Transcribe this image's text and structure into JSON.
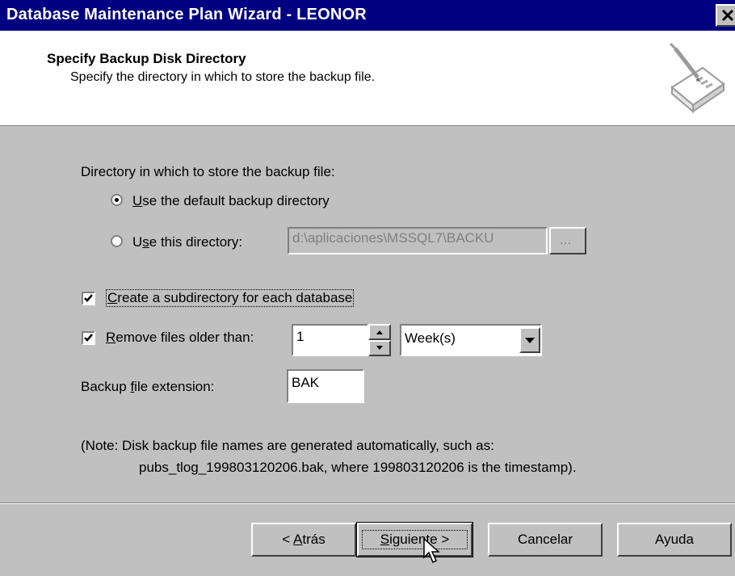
{
  "window": {
    "title": "Database Maintenance Plan Wizard - LEONOR"
  },
  "header": {
    "title": "Specify Backup Disk Directory",
    "subtitle": "Specify the directory in which to store the backup file."
  },
  "form": {
    "directory_label": "Directory in which to store the backup file:",
    "radio_default": {
      "u": "U",
      "rest": "se the default backup directory",
      "selected": true
    },
    "radio_this": {
      "pre": "U",
      "u": "s",
      "rest": "e this directory:",
      "selected": false
    },
    "directory_value": "d:\\aplicaciones\\MSSQL7\\BACKU",
    "browse_label": "...",
    "create_subdir": {
      "u": "C",
      "rest": "reate a subdirectory for each database",
      "checked": true
    },
    "remove_files": {
      "u": "R",
      "rest": "emove files older than:",
      "checked": true
    },
    "remove_count": "1",
    "remove_unit": "Week(s)",
    "extension_label": {
      "pre": "Backup ",
      "u": "f",
      "rest": "ile extension:"
    },
    "extension_value": "BAK",
    "note_line1": "(Note: Disk backup file names are generated automatically, such as:",
    "note_line2": "pubs_tlog_199803120206.bak, where 199803120206 is the timestamp)."
  },
  "buttons": {
    "back": {
      "pre": "< ",
      "u": "A",
      "rest": "trás"
    },
    "next": {
      "u": "S",
      "rest": "iguiente >"
    },
    "cancel": "Cancelar",
    "help": "Ayuda"
  }
}
